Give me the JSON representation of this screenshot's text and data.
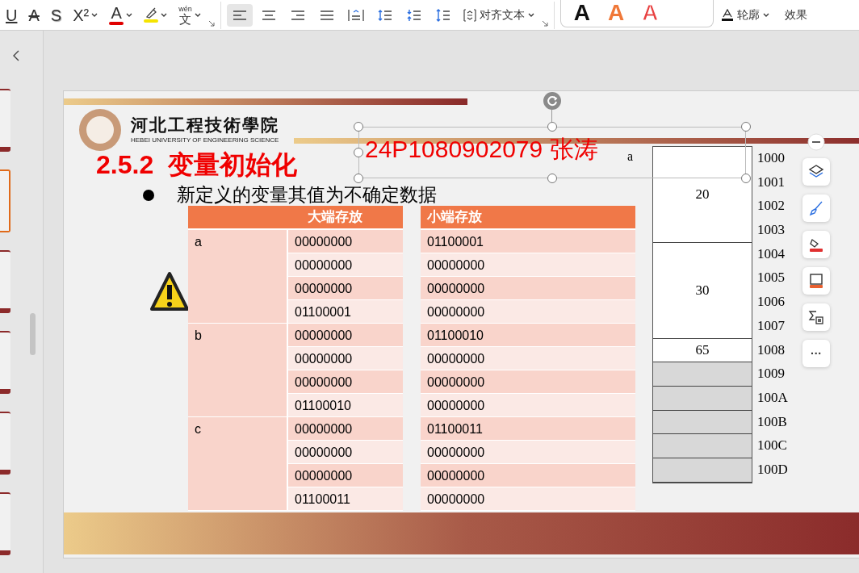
{
  "toolbar": {
    "format_buttons": [
      {
        "kind": "underline",
        "glyph": "U"
      },
      {
        "kind": "strike",
        "glyph": "A"
      },
      {
        "kind": "shadow",
        "glyph": "S"
      },
      {
        "kind": "superscript",
        "glyph": "X²",
        "caret": true
      },
      {
        "kind": "font_color",
        "glyph": "A",
        "caret": true,
        "color": "#e00000"
      },
      {
        "kind": "highlight",
        "caret": true,
        "color": "#f5e400"
      },
      {
        "kind": "phonetic",
        "glyph": "文",
        "ruby": "wén",
        "caret": true
      }
    ],
    "align_buttons": [
      {
        "kind": "left",
        "selected": true
      },
      {
        "kind": "center",
        "selected": false
      },
      {
        "kind": "right",
        "selected": false
      },
      {
        "kind": "justify",
        "selected": false
      },
      {
        "kind": "distribute",
        "selected": false
      },
      {
        "kind": "spacing_up",
        "selected": false
      },
      {
        "kind": "spacing_down",
        "selected": false
      },
      {
        "kind": "line_spacing",
        "selected": false
      }
    ],
    "align_text_label": "对齐文本",
    "styles": [
      {
        "kind": "fill",
        "glyph": "A",
        "color": "#111111"
      },
      {
        "kind": "fill",
        "glyph": "A",
        "color": "#f07838"
      },
      {
        "kind": "outline",
        "glyph": "A",
        "color": "#e84040"
      }
    ],
    "outline_label": "轮廓",
    "effects_label": "效果"
  },
  "thumbnails": [
    {
      "selected": false
    },
    {
      "selected": true
    },
    {
      "selected": false
    },
    {
      "selected": false
    },
    {
      "selected": false
    },
    {
      "selected": false
    }
  ],
  "slide": {
    "school_name": "河北工程技術學院",
    "school_name_en": "HEBEI UNIVERSITY OF ENGINEERING SCIENCE",
    "section_title": "2.5.2  变量初始化",
    "bullet": "新定义的变量其值为不确定数据",
    "selected_text": "24P1080902079 张涛",
    "big_endian_table": {
      "columns": [
        "大端存放"
      ],
      "groups": [
        {
          "label": "a",
          "values": [
            "00000000",
            "00000000",
            "00000000",
            "01100001"
          ]
        },
        {
          "label": "b",
          "values": [
            "00000000",
            "00000000",
            "00000000",
            "01100010"
          ]
        },
        {
          "label": "c",
          "values": [
            "00000000",
            "00000000",
            "00000000",
            "01100011"
          ]
        }
      ]
    },
    "little_endian_table": {
      "columns": [
        "小端存放"
      ],
      "values": [
        "01100001",
        "00000000",
        "00000000",
        "00000000",
        "01100010",
        "00000000",
        "00000000",
        "00000000",
        "01100011",
        "00000000",
        "00000000",
        "00000000"
      ]
    },
    "memory_label": "a",
    "memory_cells": [
      {
        "kind": "int",
        "value": "20"
      },
      {
        "kind": "int",
        "value": "30"
      },
      {
        "kind": "char",
        "value": "65"
      },
      {
        "kind": "free"
      },
      {
        "kind": "free"
      },
      {
        "kind": "free"
      },
      {
        "kind": "free"
      },
      {
        "kind": "free"
      }
    ],
    "addresses": [
      "1000",
      "1001",
      "1002",
      "1003",
      "1004",
      "1005",
      "1006",
      "1007",
      "1008",
      "1009",
      "100A",
      "100B",
      "100C",
      "100D"
    ]
  },
  "float_tools": [
    {
      "kind": "layers"
    },
    {
      "kind": "brush"
    },
    {
      "kind": "fill"
    },
    {
      "kind": "border"
    },
    {
      "kind": "formula"
    },
    {
      "kind": "more",
      "glyph": "···"
    }
  ]
}
